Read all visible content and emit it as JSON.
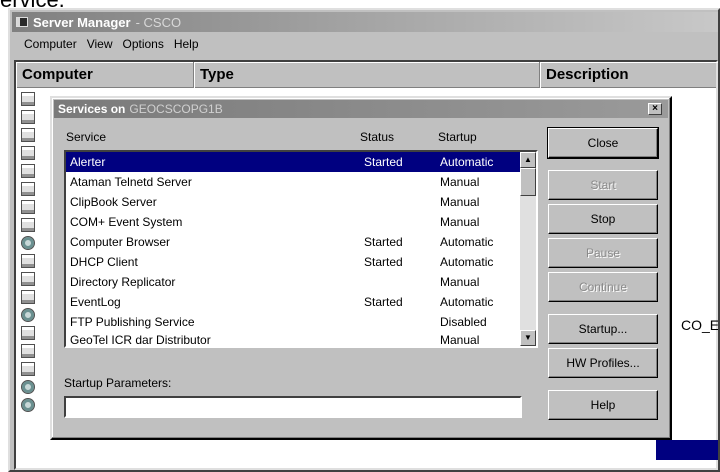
{
  "page_caption": "ervice.",
  "server_manager": {
    "title": "Server Manager",
    "title_suffix": "- CSCO",
    "menu": [
      "Computer",
      "View",
      "Options",
      "Help"
    ],
    "columns": [
      "Computer",
      "Type",
      "Description"
    ],
    "background_fragment": "CO_EN"
  },
  "dialog": {
    "title": "Services on",
    "title_host": "GEOCSCOPG1B",
    "close_glyph": "×",
    "column_headers": {
      "service": "Service",
      "status": "Status",
      "startup": "Startup"
    },
    "services": [
      {
        "name": "Alerter",
        "status": "Started",
        "startup": "Automatic"
      },
      {
        "name": "Ataman Telnetd Server",
        "status": "",
        "startup": "Manual"
      },
      {
        "name": "ClipBook Server",
        "status": "",
        "startup": "Manual"
      },
      {
        "name": "COM+ Event System",
        "status": "",
        "startup": "Manual"
      },
      {
        "name": "Computer Browser",
        "status": "Started",
        "startup": "Automatic"
      },
      {
        "name": "DHCP Client",
        "status": "Started",
        "startup": "Automatic"
      },
      {
        "name": "Directory Replicator",
        "status": "",
        "startup": "Manual"
      },
      {
        "name": "EventLog",
        "status": "Started",
        "startup": "Automatic"
      },
      {
        "name": "FTP Publishing Service",
        "status": "",
        "startup": "Disabled"
      },
      {
        "name": "GeoTel ICR dar Distributor",
        "status": "",
        "startup": "Manual"
      }
    ],
    "buttons": {
      "close": "Close",
      "start": "Start",
      "stop": "Stop",
      "pause": "Pause",
      "continue": "Continue",
      "startup": "Startup...",
      "hw_profiles": "HW Profiles...",
      "help": "Help"
    },
    "startup_parameters_label": "Startup Parameters:",
    "startup_parameters_value": ""
  },
  "colors": {
    "selection": "#000080",
    "face": "#c0c0c0",
    "disabled_text": "#8a8a8a"
  }
}
